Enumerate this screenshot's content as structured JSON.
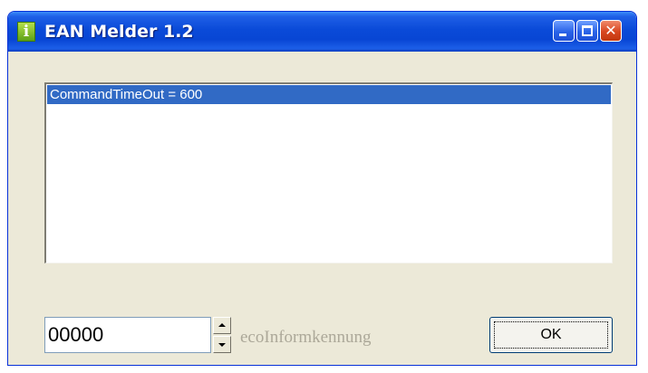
{
  "window": {
    "title": "EAN Melder 1.2",
    "app_icon_glyph": "i",
    "app_icon": "info-icon",
    "accent_color": "#0a4ad8"
  },
  "title_buttons": {
    "minimize": "minimize-icon",
    "maximize": "maximize-icon",
    "close": "close-icon",
    "close_glyph": "✕"
  },
  "list": {
    "items": [
      {
        "text": "CommandTimeOut = 600",
        "selected": true
      }
    ],
    "selection_color": "#316ac5"
  },
  "code_field": {
    "value": "00000",
    "label": "ecoInformkennung"
  },
  "spinner": {
    "up": "chevron-up-icon",
    "down": "chevron-down-icon"
  },
  "ok_button": {
    "label": "OK"
  }
}
